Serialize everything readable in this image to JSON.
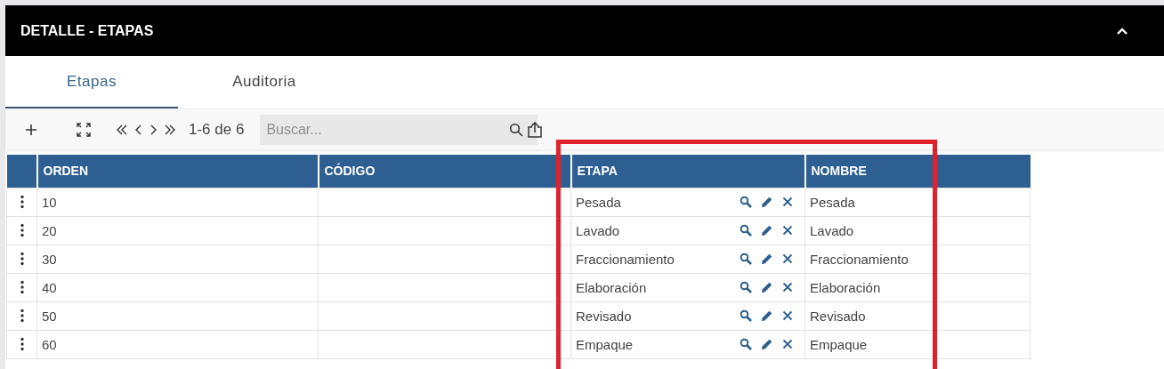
{
  "panel": {
    "title": "DETALLE - ETAPAS",
    "expanded": true
  },
  "tabs": [
    {
      "label": "Etapas",
      "selected": true
    },
    {
      "label": "Auditoria",
      "selected": false
    }
  ],
  "toolbar": {
    "page_info": "1-6 de 6",
    "search": {
      "placeholder": "Buscar..."
    }
  },
  "table": {
    "columns": [
      "ORDEN",
      "CÓDIGO",
      "ETAPA",
      "NOMBRE"
    ],
    "rows": [
      {
        "orden": "10",
        "codigo": "",
        "etapa": "Pesada",
        "nombre": "Pesada"
      },
      {
        "orden": "20",
        "codigo": "",
        "etapa": "Lavado",
        "nombre": "Lavado"
      },
      {
        "orden": "30",
        "codigo": "",
        "etapa": "Fraccionamiento",
        "nombre": "Fraccionamiento"
      },
      {
        "orden": "40",
        "codigo": "",
        "etapa": "Elaboración",
        "nombre": "Elaboración"
      },
      {
        "orden": "50",
        "codigo": "",
        "etapa": "Revisado",
        "nombre": "Revisado"
      },
      {
        "orden": "60",
        "codigo": "",
        "etapa": "Empaque",
        "nombre": "Empaque"
      }
    ]
  }
}
